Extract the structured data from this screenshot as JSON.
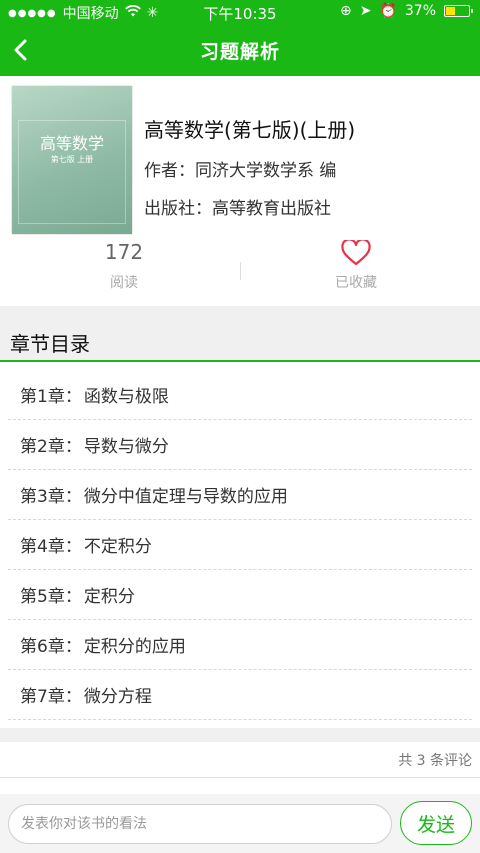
{
  "status_bar": {
    "carrier": "中国移动",
    "time": "下午10:35",
    "battery": "37%",
    "battery_level": 0.37
  },
  "nav": {
    "title": "习题解析",
    "back_icon": "chevron-left-icon"
  },
  "book": {
    "cover_title": "高等数学",
    "cover_edition": "第七版 上册",
    "title": "高等数学(第七版)(上册)",
    "author": "作者：同济大学数学系 编",
    "publisher": "出版社：高等教育出版社"
  },
  "stats": {
    "read_count": "172",
    "read_label": "阅读",
    "fav_label": "已收藏"
  },
  "section": {
    "title": "章节目录"
  },
  "chapters": [
    {
      "no": "第1章：",
      "name": "函数与极限"
    },
    {
      "no": "第2章：",
      "name": "导数与微分"
    },
    {
      "no": "第3章：",
      "name": "微分中值定理与导数的应用"
    },
    {
      "no": "第4章：",
      "name": "不定积分"
    },
    {
      "no": "第5章：",
      "name": "定积分"
    },
    {
      "no": "第6章：",
      "name": "定积分的应用"
    },
    {
      "no": "第7章：",
      "name": "微分方程"
    }
  ],
  "comments": {
    "count_text": "共 3 条评论"
  },
  "composer": {
    "placeholder": "发表你对该书的看法",
    "send_label": "发送"
  },
  "colors": {
    "brand": "#19b814",
    "heart": "#e8324a"
  }
}
